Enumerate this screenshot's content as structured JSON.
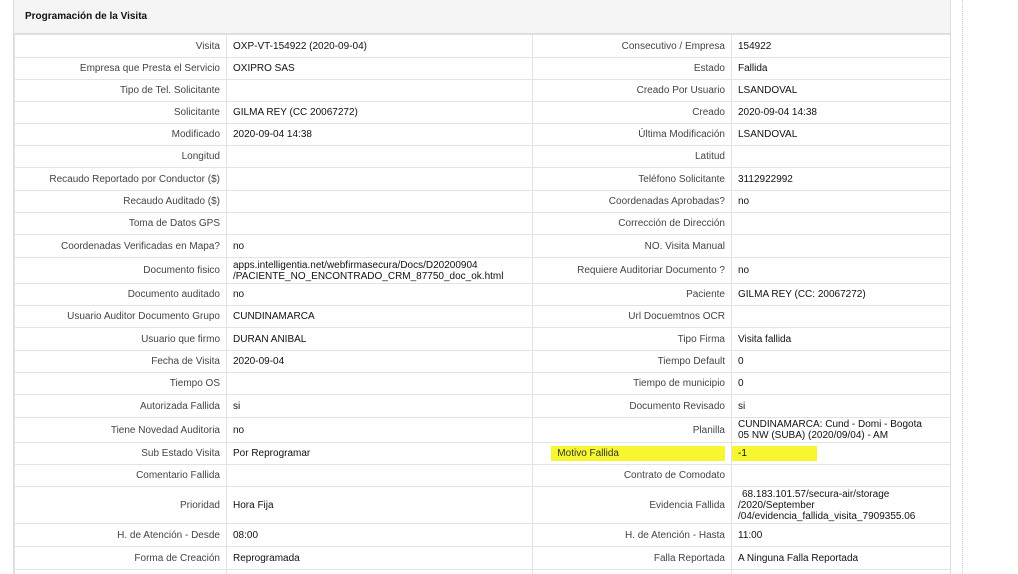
{
  "panel": {
    "title": "Programación de la Visita"
  },
  "rows": [
    {
      "l1": "Visita",
      "v1": "OXP-VT-154922 (2020-09-04)",
      "l2": "Consecutivo / Empresa",
      "v2": "154922"
    },
    {
      "l1": "Empresa que Presta el Servicio",
      "v1": "OXIPRO SAS",
      "l2": "Estado",
      "v2": "Fallida"
    },
    {
      "l1": "Tipo de Tel. Solicitante",
      "v1": "",
      "l2": "Creado Por Usuario",
      "v2": "LSANDOVAL"
    },
    {
      "l1": "Solicitante",
      "v1": "GILMA REY (CC 20067272)",
      "l2": "Creado",
      "v2": "2020-09-04 14:38"
    },
    {
      "l1": "Modificado",
      "v1": "2020-09-04 14:38",
      "l2": "Última Modificación",
      "v2": "LSANDOVAL"
    },
    {
      "l1": "Longitud",
      "v1": "",
      "l2": "Latitud",
      "v2": ""
    },
    {
      "l1": "Recaudo Reportado por Conductor ($)",
      "v1": "",
      "l2": "Teléfono Solicitante",
      "v2": "3112922992"
    },
    {
      "l1": "Recaudo Auditado ($)",
      "v1": "",
      "l2": "Coordenadas Aprobadas?",
      "v2": "no"
    },
    {
      "l1": "Toma de Datos GPS",
      "v1": "",
      "l2": "Corrección de Dirección",
      "v2": ""
    },
    {
      "l1": "Coordenadas Verificadas en Mapa?",
      "v1": "no",
      "l2": "NO. Visita Manual",
      "v2": ""
    },
    {
      "l1": "Documento fisico",
      "v1a": "apps.intelligentia.net/webfirmasecura/Docs/D20200904",
      "v1b": "/PACIENTE_NO_ENCONTRADO_CRM_87750_doc_ok.html",
      "l2": "Requiere Auditoriar Documento ?",
      "v2": "no"
    },
    {
      "l1": "Documento auditado",
      "v1": "no",
      "l2": "Paciente",
      "v2": "GILMA REY (CC: 20067272)"
    },
    {
      "l1": "Usuario Auditor Documento Grupo",
      "v1": "CUNDINAMARCA",
      "l2": "Url Docuemtnos OCR",
      "v2": ""
    },
    {
      "l1": "Usuario que firmo",
      "v1": "DURAN ANIBAL",
      "l2": "Tipo Firma",
      "v2": "Visita fallida"
    },
    {
      "l1": "Fecha de Visita",
      "v1": "2020-09-04",
      "l2": "Tiempo Default",
      "v2": "0"
    },
    {
      "l1": "Tiempo OS",
      "v1": "",
      "l2": "Tiempo de municipio",
      "v2": "0"
    },
    {
      "l1": "Autorizada Fallida",
      "v1": "si",
      "l2": "Documento Revisado",
      "v2": "si"
    },
    {
      "l1": "Tiene Novedad Auditoria",
      "v1": "no",
      "l2": "Planilla",
      "v2a": "CUNDINAMARCA: Cund - Domi - Bogota",
      "v2b": "05 NW (SUBA) (2020/09/04) - AM"
    },
    {
      "l1": "Sub Estado Visita",
      "v1": "Por Reprogramar",
      "l2": "Motivo Fallida",
      "v2": "-1"
    },
    {
      "l1": "Comentario Fallida",
      "v1": "",
      "l2": "Contrato de Comodato",
      "v2": ""
    },
    {
      "l1": "Prioridad",
      "v1": "Hora Fija",
      "l2": "Evidencia Fallida",
      "v2a": "68.183.101.57/secura-air/storage",
      "v2b": "/2020/September",
      "v2c": "/04/evidencia_fallida_visita_7909355.06"
    },
    {
      "l1": "H. de Atención - Desde",
      "v1": "08:00",
      "l2": "H. de Atención - Hasta",
      "v2": "11:00"
    },
    {
      "l1": "Forma de Creación",
      "v1": "Reprogramada",
      "l2": "Falla Reportada",
      "v2": "A Ninguna Falla Reportada"
    }
  ]
}
